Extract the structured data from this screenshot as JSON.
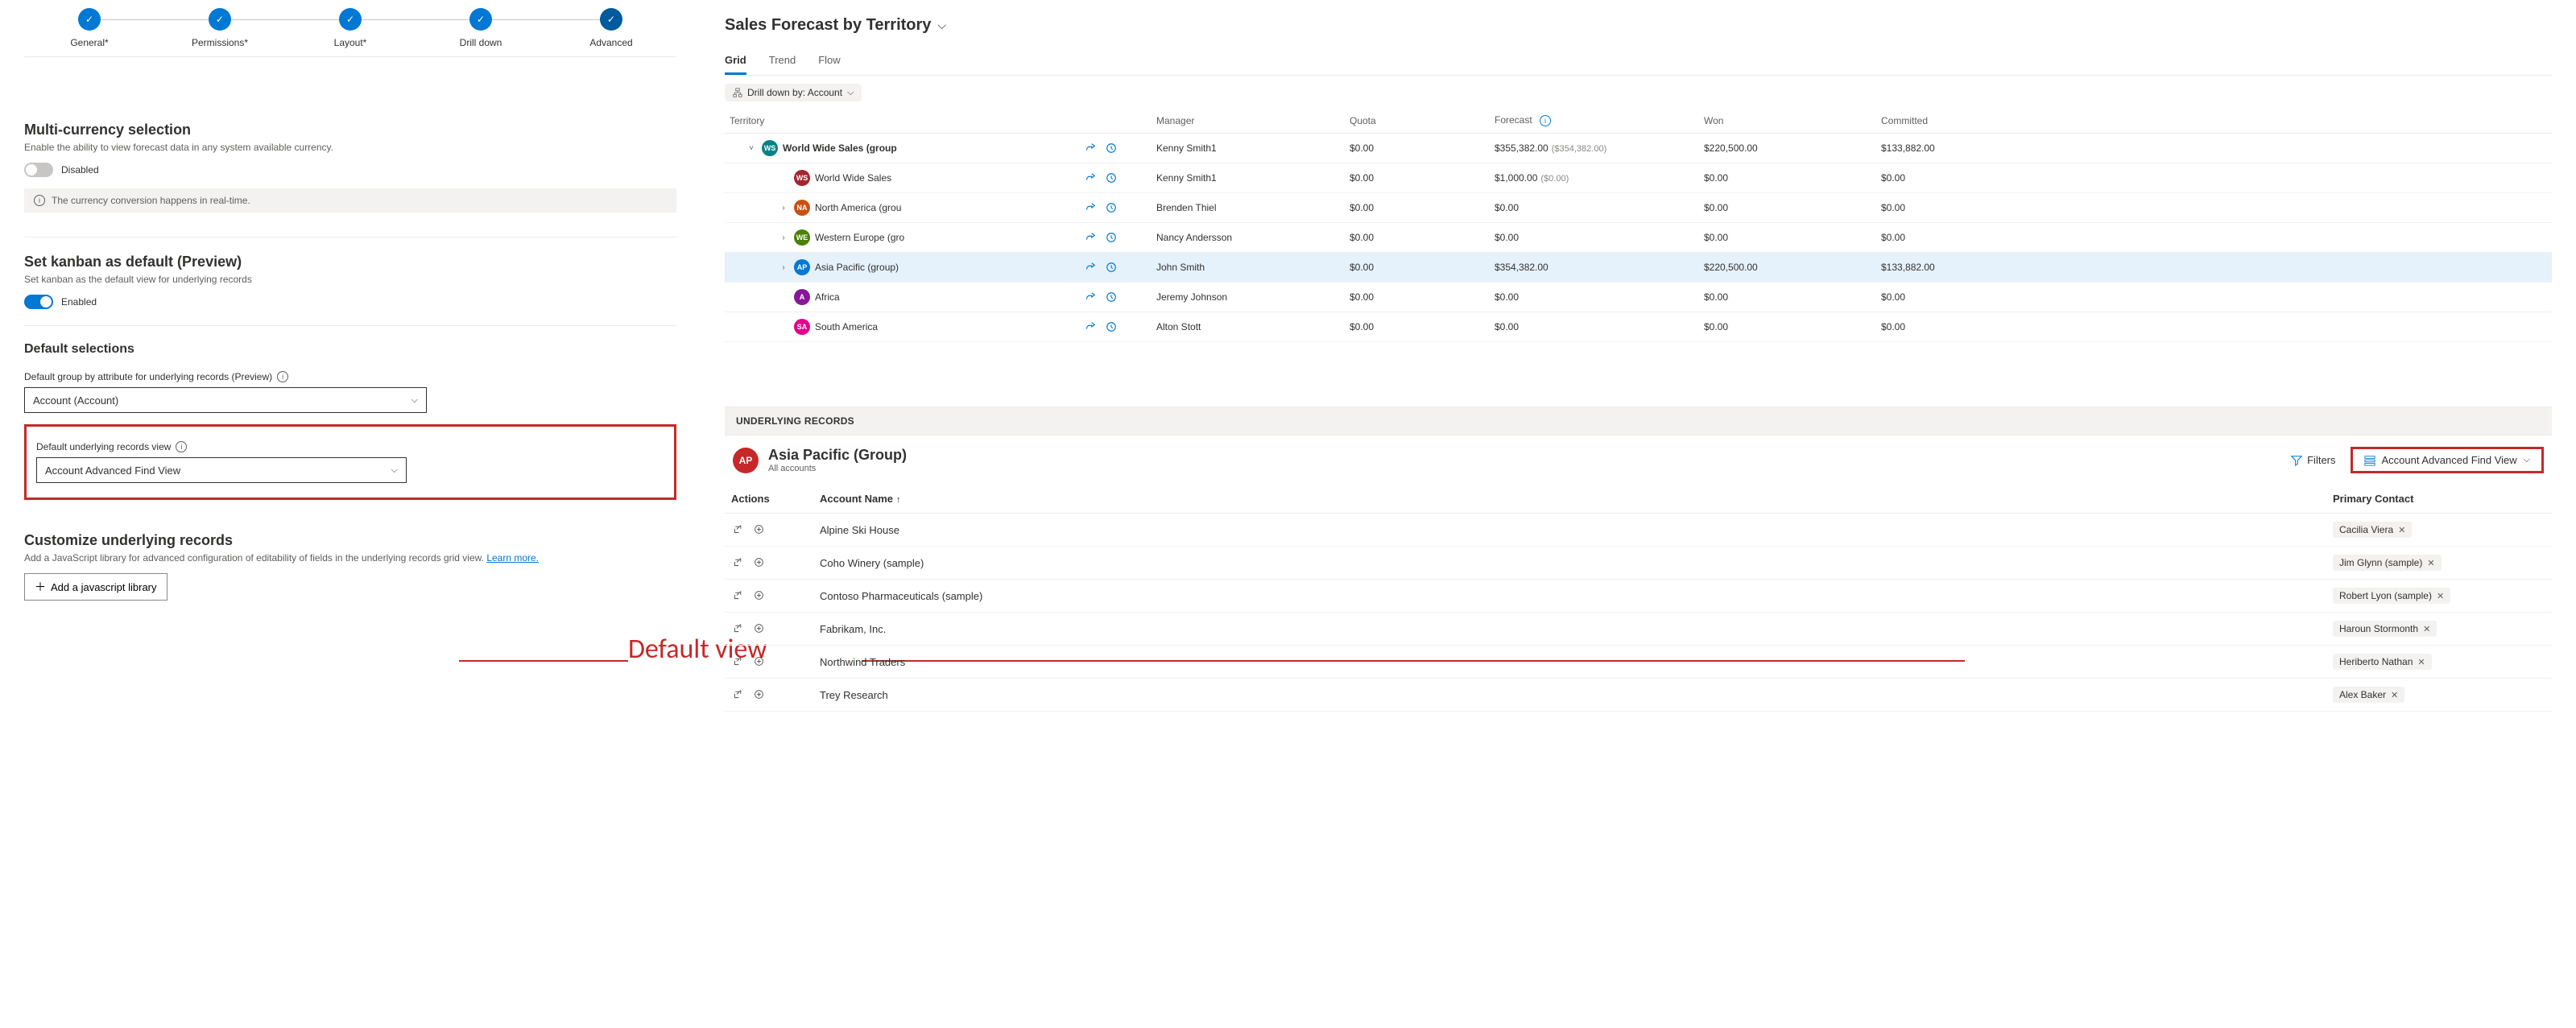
{
  "stepper": {
    "steps": [
      {
        "label": "General*"
      },
      {
        "label": "Permissions*"
      },
      {
        "label": "Layout*"
      },
      {
        "label": "Drill down"
      },
      {
        "label": "Advanced"
      }
    ]
  },
  "multi_currency": {
    "title": "Multi-currency selection",
    "desc": "Enable the ability to view forecast data in any system available currency.",
    "toggle_label": "Disabled",
    "info_text": "The currency conversion happens in real-time."
  },
  "kanban": {
    "title": "Set kanban as default (Preview)",
    "desc": "Set kanban as the default view for underlying records",
    "toggle_label": "Enabled"
  },
  "defaults": {
    "section_title": "Default selections",
    "groupby_label": "Default group by attribute for underlying records (Preview)",
    "groupby_value": "Account (Account)",
    "view_label": "Default underlying records view",
    "view_value": "Account Advanced Find View"
  },
  "customize": {
    "title": "Customize underlying records",
    "desc_pre": "Add a JavaScript library for advanced configuration of editability of fields in the underlying records grid view. ",
    "learn_more": "Learn more.",
    "button": "Add a javascript library"
  },
  "annotation": {
    "label": "Default view"
  },
  "forecast": {
    "title": "Sales Forecast by Territory",
    "tabs": [
      "Grid",
      "Trend",
      "Flow"
    ],
    "drilldown_pill": "Drill down by: Account",
    "columns": [
      "Territory",
      "",
      "Manager",
      "Quota",
      "Forecast",
      "Won",
      "Committed"
    ],
    "rows": [
      {
        "indent": 0,
        "expand": "˅",
        "initials": "WS",
        "bg": "#038387",
        "name": "World Wide Sales (group",
        "manager": "Kenny Smith1",
        "quota": "$0.00",
        "forecast": "$355,382.00",
        "fsub": "($354,382.00)",
        "won": "$220,500.00",
        "committed": "$133,882.00",
        "highlight": false,
        "bold": true
      },
      {
        "indent": 1,
        "expand": "",
        "initials": "WS",
        "bg": "#a4262c",
        "name": "World Wide Sales",
        "manager": "Kenny Smith1",
        "quota": "$0.00",
        "forecast": "$1,000.00",
        "fsub": "($0.00)",
        "won": "$0.00",
        "committed": "$0.00",
        "highlight": false,
        "bold": false
      },
      {
        "indent": 1,
        "expand": "›",
        "initials": "NA",
        "bg": "#ca5010",
        "name": "North America (grou",
        "manager": "Brenden Thiel",
        "quota": "$0.00",
        "forecast": "$0.00",
        "fsub": "",
        "won": "$0.00",
        "committed": "$0.00",
        "highlight": false,
        "bold": false
      },
      {
        "indent": 1,
        "expand": "›",
        "initials": "WE",
        "bg": "#498205",
        "name": "Western Europe (gro",
        "manager": "Nancy Andersson",
        "quota": "$0.00",
        "forecast": "$0.00",
        "fsub": "",
        "won": "$0.00",
        "committed": "$0.00",
        "highlight": false,
        "bold": false
      },
      {
        "indent": 1,
        "expand": "›",
        "initials": "AP",
        "bg": "#0078d4",
        "name": "Asia Pacific (group)",
        "manager": "John Smith",
        "quota": "$0.00",
        "forecast": "$354,382.00",
        "fsub": "",
        "won": "$220,500.00",
        "committed": "$133,882.00",
        "highlight": true,
        "bold": false
      },
      {
        "indent": 1,
        "expand": "",
        "initials": "A",
        "bg": "#881798",
        "name": "Africa",
        "manager": "Jeremy Johnson",
        "quota": "$0.00",
        "forecast": "$0.00",
        "fsub": "",
        "won": "$0.00",
        "committed": "$0.00",
        "highlight": false,
        "bold": false
      },
      {
        "indent": 1,
        "expand": "",
        "initials": "SA",
        "bg": "#e3008c",
        "name": "South America",
        "manager": "Alton Stott",
        "quota": "$0.00",
        "forecast": "$0.00",
        "fsub": "",
        "won": "$0.00",
        "committed": "$0.00",
        "highlight": false,
        "bold": false
      }
    ]
  },
  "underlying": {
    "header": "UNDERLYING RECORDS",
    "group_initials": "AP",
    "group_bg": "#c62828",
    "group_title": "Asia Pacific (Group)",
    "group_sub": "All accounts",
    "filters_label": "Filters",
    "view_label": "Account Advanced Find View",
    "columns": {
      "actions": "Actions",
      "account": "Account Name",
      "contact": "Primary Contact"
    },
    "rows": [
      {
        "account": "Alpine Ski House",
        "contact": "Cacilia Viera"
      },
      {
        "account": "Coho Winery (sample)",
        "contact": "Jim Glynn (sample)"
      },
      {
        "account": "Contoso Pharmaceuticals (sample)",
        "contact": "Robert Lyon (sample)"
      },
      {
        "account": "Fabrikam, Inc.",
        "contact": "Haroun Stormonth"
      },
      {
        "account": "Northwind Traders",
        "contact": "Heriberto Nathan"
      },
      {
        "account": "Trey Research",
        "contact": "Alex Baker"
      }
    ]
  }
}
